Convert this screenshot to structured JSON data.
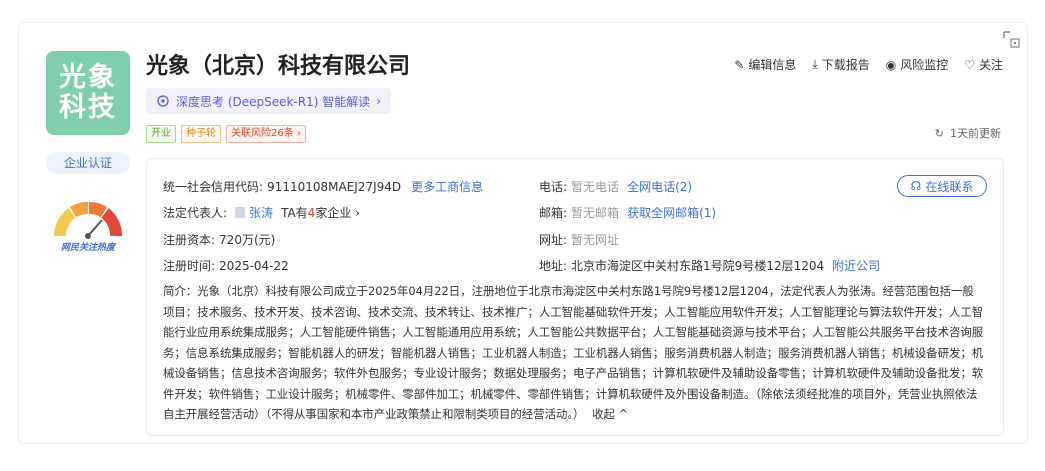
{
  "company": {
    "logo_line1": "光象",
    "logo_line2": "科技",
    "name": "光象（北京）科技有限公司",
    "cert": "企业认证",
    "heat_label": "网民关注热度"
  },
  "ai": {
    "label": "深度思考 (DeepSeek-R1) 智能解读",
    "arrow": "›"
  },
  "tags": [
    {
      "label": "开业",
      "color": "green"
    },
    {
      "label": "种子轮",
      "color": "orange"
    },
    {
      "label": "关联风险26条 ›",
      "color": "red"
    }
  ],
  "actions": {
    "edit": "编辑信息",
    "download": "下载报告",
    "monitor": "风险监控",
    "follow": "关注"
  },
  "update": "1天前更新",
  "info": {
    "credit_label": "统一社会信用代码:",
    "credit_value": "91110108MAEJ27J94D",
    "more_biz": "更多工商信息",
    "legal_label": "法定代表人:",
    "legal_name": "张涛",
    "legal_ta_prefix": "TA有",
    "legal_ta_count": "4",
    "legal_ta_suffix": "家企业 ›",
    "capital_label": "注册资本:",
    "capital_value": "720万(元)",
    "date_label": "注册时间:",
    "date_value": "2025-04-22",
    "phone_label": "电话:",
    "phone_value": "暂无电话",
    "phone_link": "全网电话(2)",
    "email_label": "邮箱:",
    "email_value": "暂无邮箱",
    "email_link": "获取全网邮箱(1)",
    "site_label": "网址:",
    "site_value": "暂无网址",
    "addr_label": "地址:",
    "addr_value": "北京市海淀区中关村东路1号院9号楼12层1204",
    "addr_link": "附近公司",
    "online": "在线联系"
  },
  "brief": {
    "text": "简介：光象（北京）科技有限公司成立于2025年04月22日，注册地位于北京市海淀区中关村东路1号院9号楼12层1204，法定代表人为张涛。经营范围包括一般项目：技术服务、技术开发、技术咨询、技术交流、技术转让、技术推广；人工智能基础软件开发；人工智能应用软件开发；人工智能理论与算法软件开发；人工智能行业应用系统集成服务；人工智能硬件销售；人工智能通用应用系统；人工智能公共数据平台；人工智能基础资源与技术平台；人工智能公共服务平台技术咨询服务；信息系统集成服务；智能机器人的研发；智能机器人销售；工业机器人制造；工业机器人销售；服务消费机器人制造；服务消费机器人销售；机械设备研发；机械设备销售；信息技术咨询服务；软件外包服务；专业设计服务；数据处理服务；电子产品销售；计算机软硬件及辅助设备零售；计算机软硬件及辅助设备批发；软件开发；软件销售；工业设计服务；机械零件、零部件加工；机械零件、零部件销售；计算机软硬件及外围设备制造。（除依法须经批准的项目外，凭营业执照依法自主开展经营活动）（不得从事国家和本市产业政策禁止和限制类项目的经营活动。）",
    "collapse": "收起 ^"
  }
}
